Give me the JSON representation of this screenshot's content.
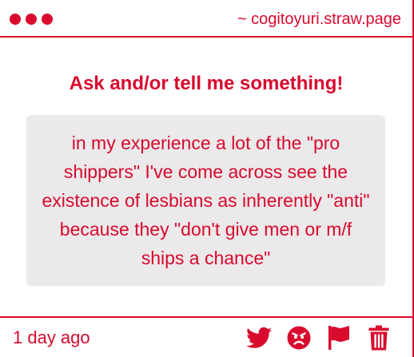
{
  "window": {
    "site_url": "~ cogitoyuri.straw.page"
  },
  "content": {
    "heading": "Ask and/or tell me something!",
    "message": "in my experience a lot of the \"pro shippers\" I've come across see the existence of lesbians as inherently \"anti\" because they \"don't give men or m/f ships a chance\""
  },
  "footer": {
    "timestamp": "1 day ago",
    "actions": [
      {
        "icon": "twitter-icon"
      },
      {
        "icon": "angry-face-icon"
      },
      {
        "icon": "flag-icon"
      },
      {
        "icon": "trash-icon"
      }
    ]
  },
  "colors": {
    "accent": "#d80a2e",
    "message_background": "#ebe9ea",
    "page_background": "#ffffff"
  }
}
